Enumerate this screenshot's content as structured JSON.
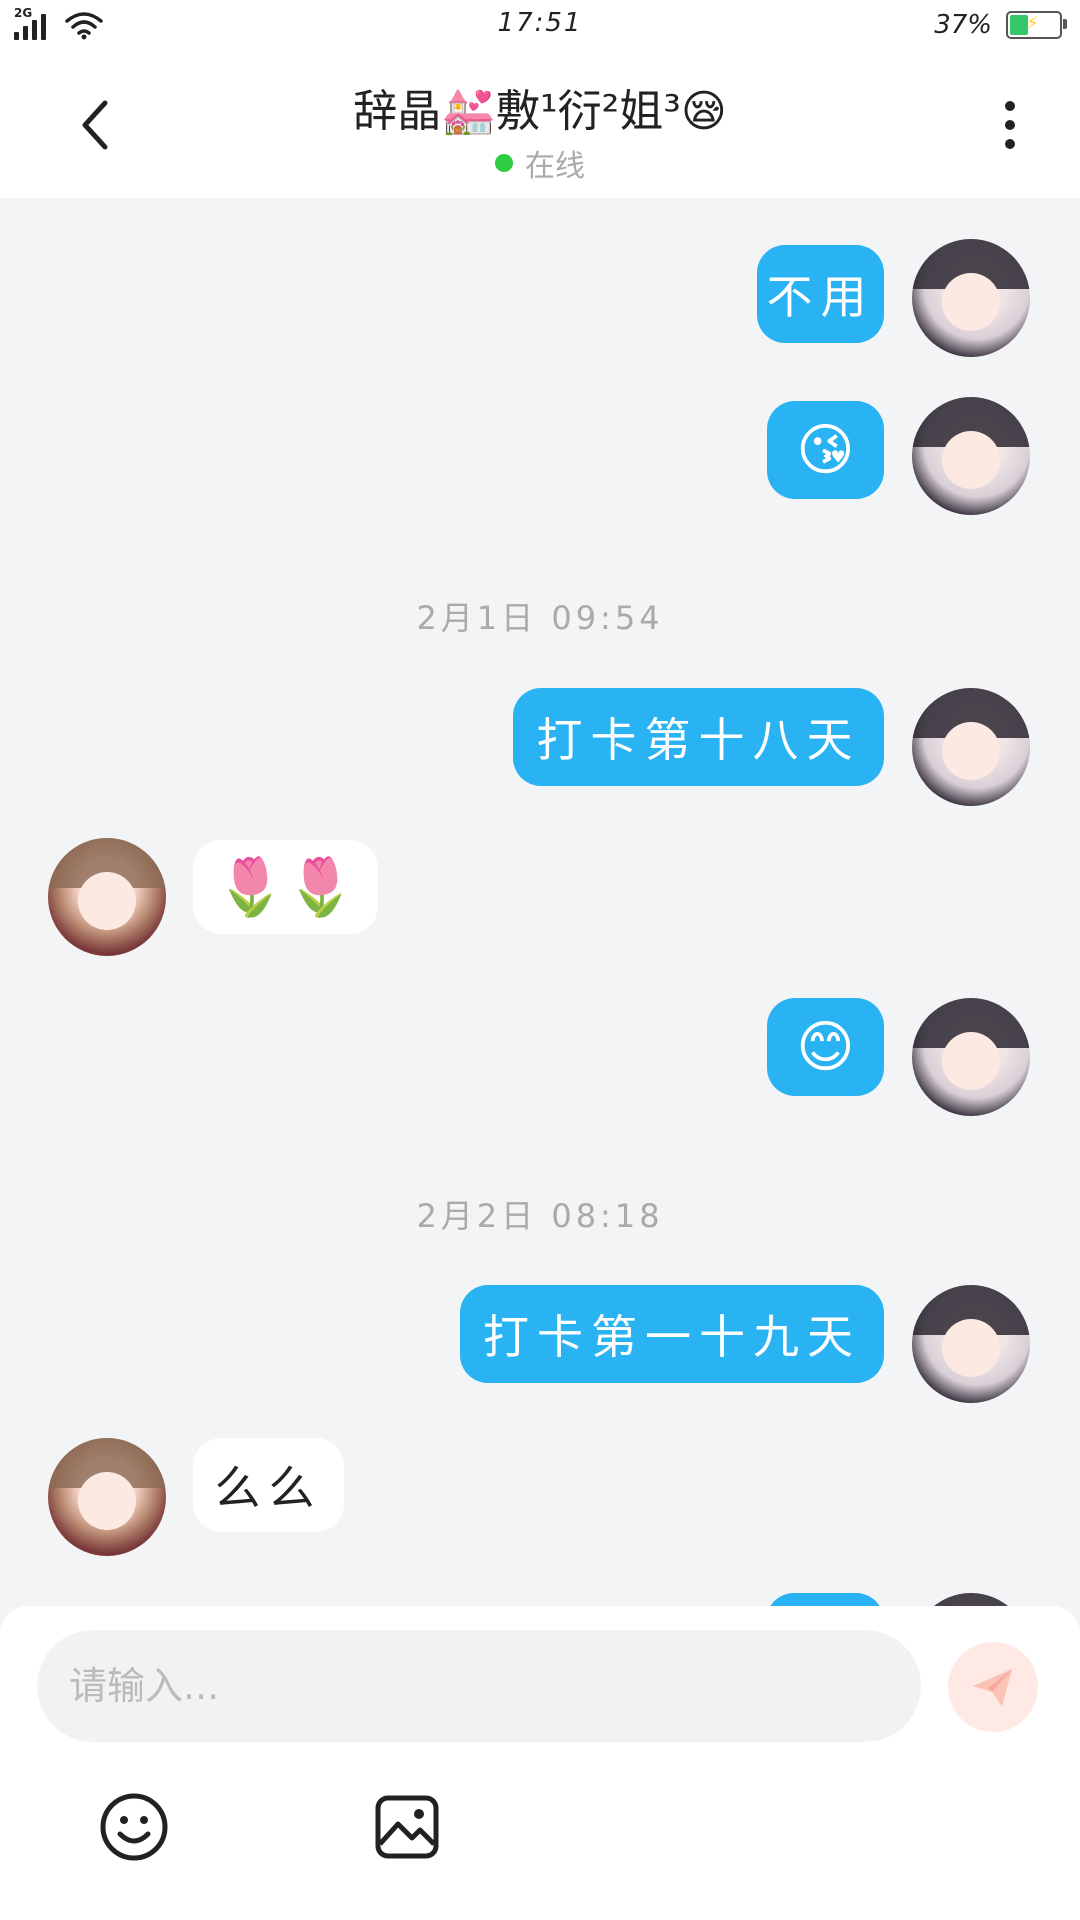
{
  "status_bar": {
    "network": "2G",
    "time": "17:51",
    "battery_percent": "37%",
    "battery_level": 0.37,
    "battery_color": "#36c76b"
  },
  "header": {
    "title": "辞晶💒敷¹衍²姐³😪",
    "status": "在线",
    "back_icon": "chevron-left-icon",
    "more_icon": "more-vertical-icon"
  },
  "colors": {
    "my_bubble": "#29b3f3",
    "their_bubble": "#ffffff",
    "background": "#f3f4f6",
    "online": "#2ecc40"
  },
  "messages": [
    {
      "from": "me",
      "text": "不用"
    },
    {
      "from": "me",
      "text": "😘"
    },
    {
      "timestamp": "2月1日 09:54"
    },
    {
      "from": "me",
      "text": "打卡第十八天"
    },
    {
      "from": "them",
      "text": "🌷🌷"
    },
    {
      "from": "me",
      "text": "😊"
    },
    {
      "timestamp": "2月2日 08:18"
    },
    {
      "from": "me",
      "text": "打卡第一十九天"
    },
    {
      "from": "them",
      "text": "么么"
    }
  ],
  "composer": {
    "placeholder": "请输入...",
    "value": "",
    "send_icon": "send-icon",
    "emoji_icon": "emoji-icon",
    "image_icon": "image-icon"
  }
}
